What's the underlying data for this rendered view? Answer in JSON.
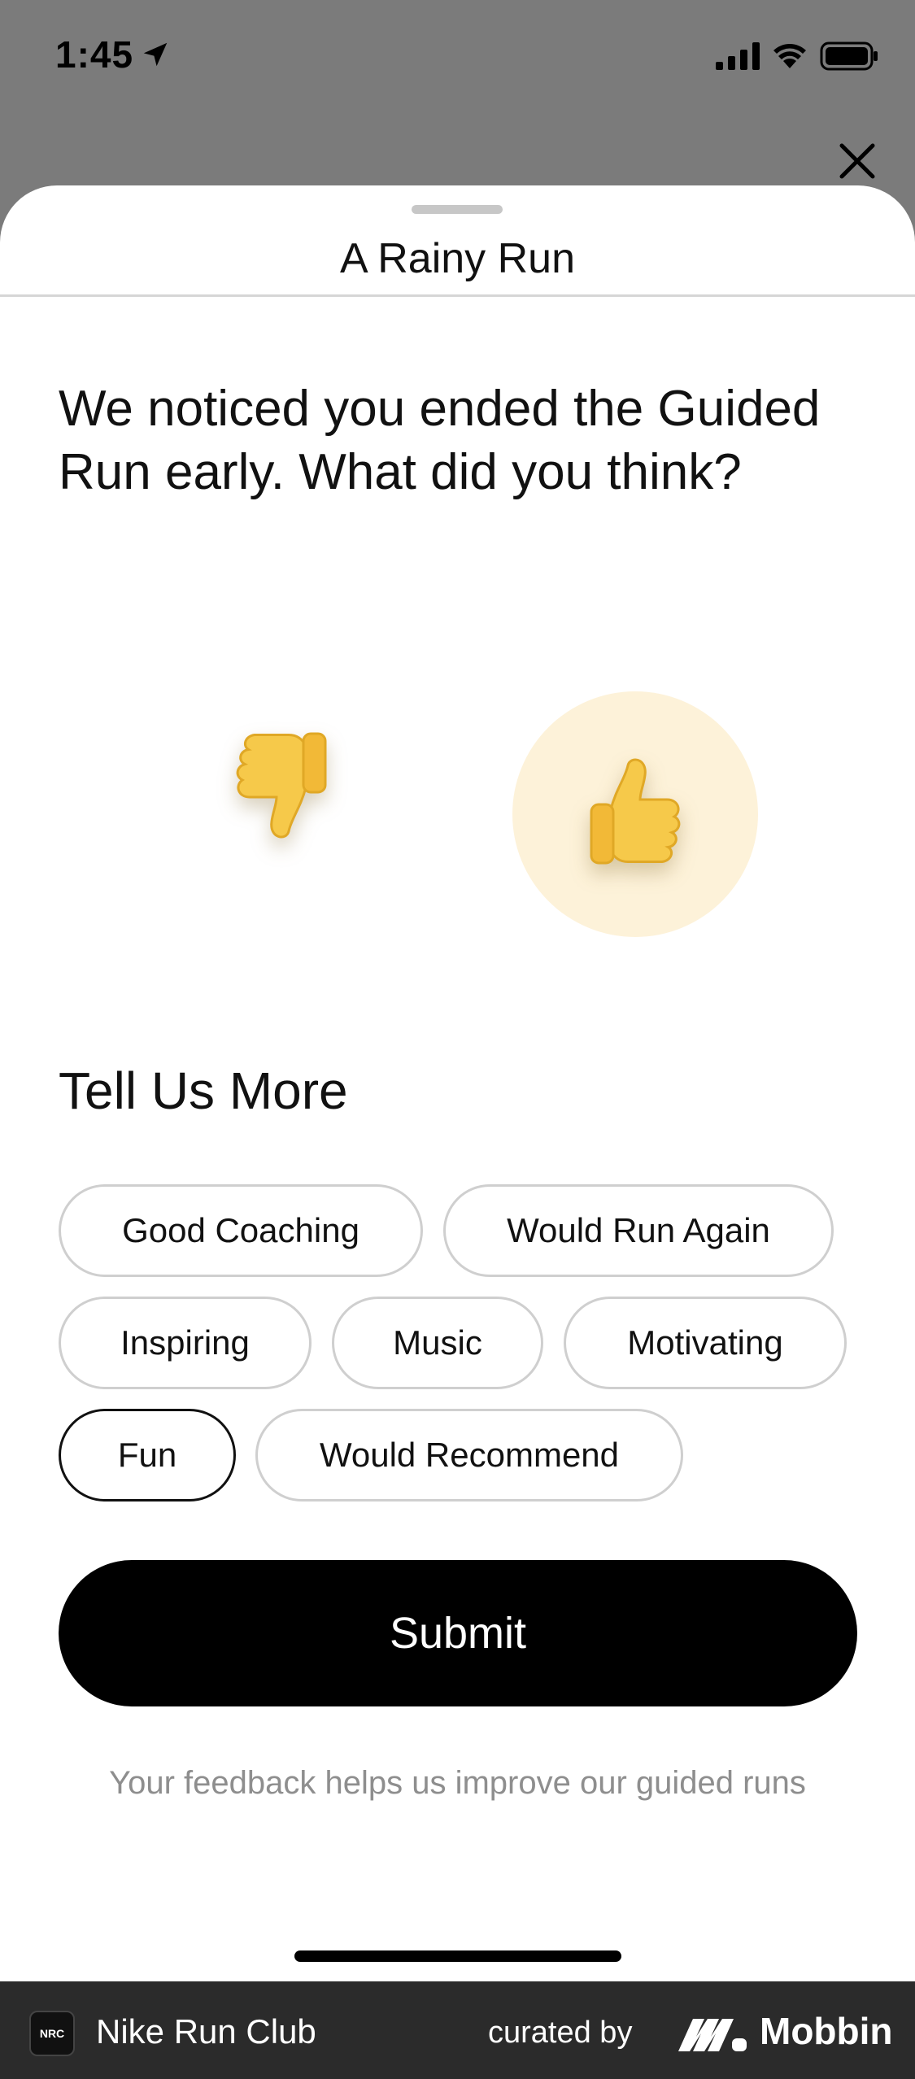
{
  "status_bar": {
    "time": "1:45",
    "icons": [
      "location-arrow-icon",
      "cellular-signal-icon",
      "wifi-icon",
      "battery-icon"
    ]
  },
  "sheet": {
    "title": "A Rainy Run",
    "question": "We noticed you ended the Guided Run early. What did you think?",
    "rating": {
      "options": [
        "thumbs-down",
        "thumbs-up"
      ],
      "selected": "thumbs-up"
    },
    "tell_us_more": {
      "title": "Tell Us More",
      "tags": [
        {
          "label": "Good Coaching",
          "selected": false
        },
        {
          "label": "Would Run Again",
          "selected": false
        },
        {
          "label": "Inspiring",
          "selected": false
        },
        {
          "label": "Music",
          "selected": false
        },
        {
          "label": "Motivating",
          "selected": false
        },
        {
          "label": "Fun",
          "selected": true
        },
        {
          "label": "Would Recommend",
          "selected": false
        }
      ]
    },
    "submit_label": "Submit",
    "footnote": "Your feedback helps us improve our guided runs"
  },
  "footer": {
    "app_logo_text": "NRC",
    "app_name": "Nike Run Club",
    "curated_label": "curated by",
    "brand": "Mobbin"
  },
  "colors": {
    "backdrop": "#7b7b7b",
    "selected_thumb_bg": "#fdf2d9",
    "submit_bg": "#000000",
    "chip_border": "#cfcfcf",
    "footer_bg": "#2b2b2b"
  }
}
